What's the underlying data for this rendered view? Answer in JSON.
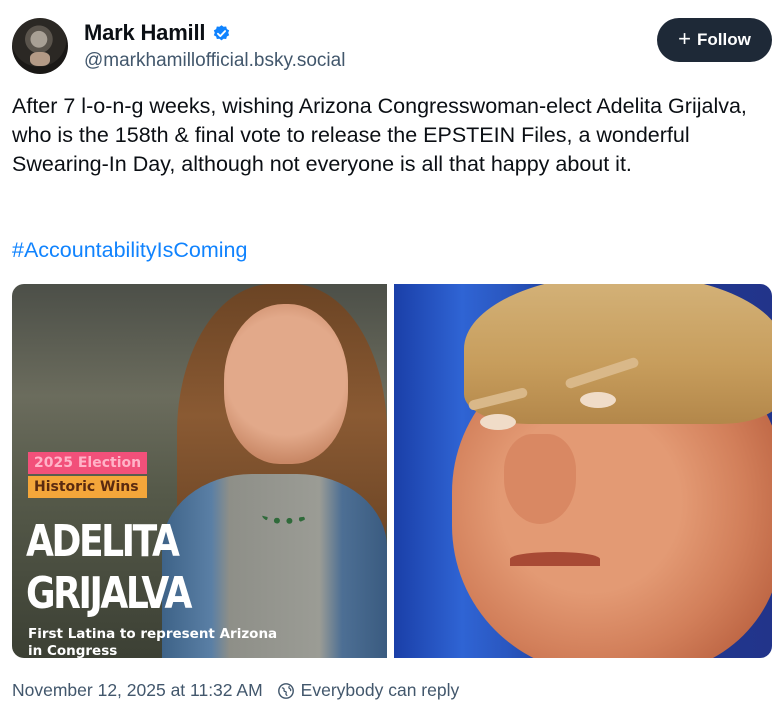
{
  "author": {
    "display_name": "Mark Hamill",
    "handle": "@markhamillofficial.bsky.social",
    "verified_color": "#1083fe"
  },
  "actions": {
    "follow_label": "Follow"
  },
  "post": {
    "text": "After 7 l-o-n-g weeks, wishing Arizona Congresswoman-elect Adelita Grijalva, who is the 158th & final vote to release the EPSTEIN Files, a wonderful Swearing-In Day, although not everyone is all that happy about it.",
    "hashtag": "#AccountabilityIsComing",
    "images": {
      "left": {
        "badge_line1": "2025 Election",
        "badge_line2": "Historic Wins",
        "name_line1": "ADELITA",
        "name_line2": "GRIJALVA",
        "caption": "First Latina to represent Arizona in Congress"
      }
    }
  },
  "footer": {
    "timestamp": "November 12, 2025 at 11:32 AM",
    "reply_setting": "Everybody can reply"
  },
  "colors": {
    "accent": "#1083fe",
    "button_bg": "#1e2937",
    "muted_text": "#42576c"
  }
}
